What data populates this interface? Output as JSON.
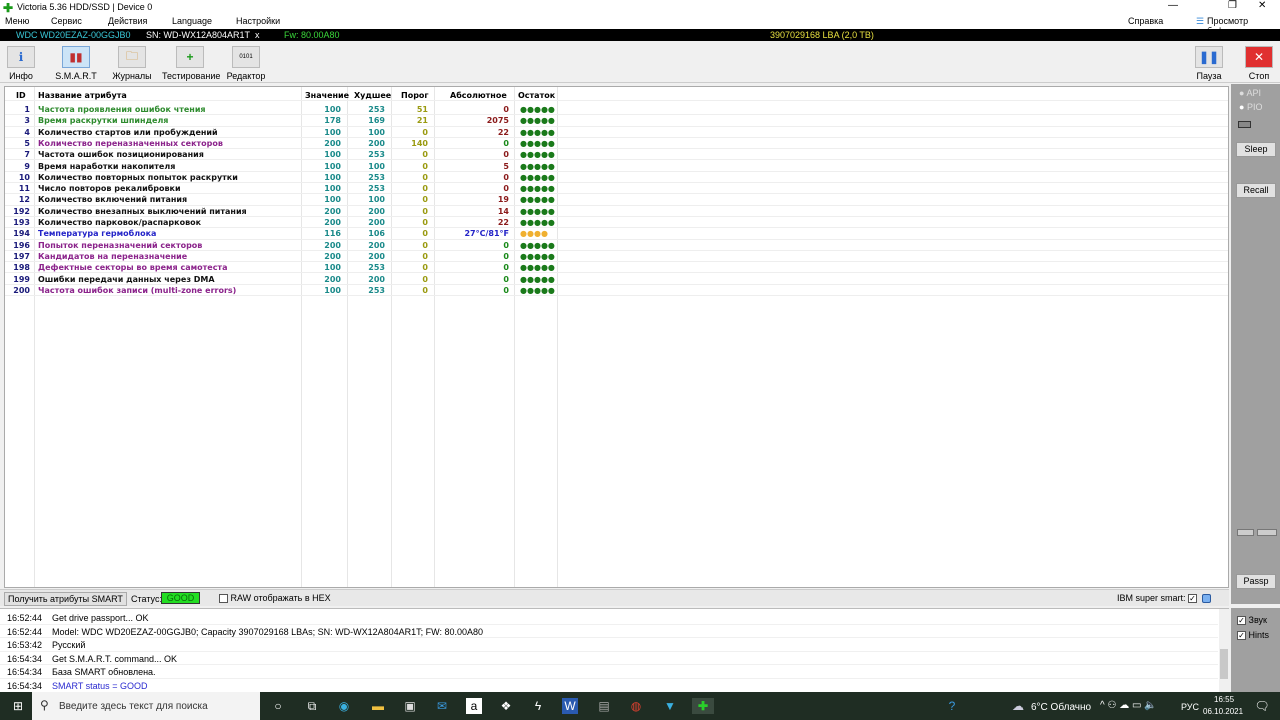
{
  "window": {
    "title": "Victoria 5.36 HDD/SSD | Device 0"
  },
  "menu": [
    "Меню",
    "Сервис",
    "Действия",
    "Language",
    "Настройки"
  ],
  "menu_right": {
    "help": "Справка",
    "buffer": "Просмотр буфера"
  },
  "infobar": {
    "model": "WDC WD20EZAZ-00GGJB0",
    "serial": "SN: WD-WX12A804AR1T",
    "close": "x",
    "fw": "Fw: 80.00A80",
    "lba": "3907029168 LBA (2,0 TB)"
  },
  "toolbar": {
    "info": "Инфо",
    "smart": "S.M.A.R.T",
    "logs": "Журналы",
    "test": "Тестирование",
    "editor": "Редактор",
    "pause": "Пауза",
    "stop": "Стоп"
  },
  "table": {
    "headers": {
      "id": "ID",
      "name": "Название атрибута",
      "value": "Значение",
      "worst": "Худшее",
      "threshold": "Порог",
      "raw": "Абсолютное",
      "rest": "Остаток"
    },
    "rows": [
      {
        "id": "1",
        "name": "Частота проявления ошибок чтения",
        "value": "100",
        "worst": "253",
        "threshold": "51",
        "raw": "0",
        "rest": "●●●●●",
        "nc": "#2e8b2e",
        "rc": "#8b1a1a"
      },
      {
        "id": "3",
        "name": "Время раскрутки шпинделя",
        "value": "178",
        "worst": "169",
        "threshold": "21",
        "raw": "2075",
        "rest": "●●●●●",
        "nc": "#2e8b2e",
        "rc": "#8b1a1a"
      },
      {
        "id": "4",
        "name": "Количество стартов или пробуждений",
        "value": "100",
        "worst": "100",
        "threshold": "0",
        "raw": "22",
        "rest": "●●●●●",
        "nc": "#111",
        "rc": "#8b1a1a"
      },
      {
        "id": "5",
        "name": "Количество переназначенных секторов",
        "value": "200",
        "worst": "200",
        "threshold": "140",
        "raw": "0",
        "rest": "●●●●●",
        "nc": "#8b238b",
        "rc": "#1a8a1a"
      },
      {
        "id": "7",
        "name": "Частота ошибок позиционирования",
        "value": "100",
        "worst": "253",
        "threshold": "0",
        "raw": "0",
        "rest": "●●●●●",
        "nc": "#111",
        "rc": "#8b1a1a"
      },
      {
        "id": "9",
        "name": "Время наработки накопителя",
        "value": "100",
        "worst": "100",
        "threshold": "0",
        "raw": "5",
        "rest": "●●●●●",
        "nc": "#111",
        "rc": "#8b1a1a"
      },
      {
        "id": "10",
        "name": "Количество повторных попыток раскрутки",
        "value": "100",
        "worst": "253",
        "threshold": "0",
        "raw": "0",
        "rest": "●●●●●",
        "nc": "#111",
        "rc": "#8b1a1a"
      },
      {
        "id": "11",
        "name": "Число повторов рекалибровки",
        "value": "100",
        "worst": "253",
        "threshold": "0",
        "raw": "0",
        "rest": "●●●●●",
        "nc": "#111",
        "rc": "#8b1a1a"
      },
      {
        "id": "12",
        "name": "Количество включений питания",
        "value": "100",
        "worst": "100",
        "threshold": "0",
        "raw": "19",
        "rest": "●●●●●",
        "nc": "#111",
        "rc": "#8b1a1a"
      },
      {
        "id": "192",
        "name": "Количество внезапных выключений питания",
        "value": "200",
        "worst": "200",
        "threshold": "0",
        "raw": "14",
        "rest": "●●●●●",
        "nc": "#111",
        "rc": "#8b1a1a"
      },
      {
        "id": "193",
        "name": "Количество парковок/распарковок",
        "value": "200",
        "worst": "200",
        "threshold": "0",
        "raw": "22",
        "rest": "●●●●●",
        "nc": "#111",
        "rc": "#8b1a1a"
      },
      {
        "id": "194",
        "name": "Температура гермоблока",
        "value": "116",
        "worst": "106",
        "threshold": "0",
        "raw": "27°C/81°F",
        "rest": "●●●●",
        "nc": "#2323c8",
        "rc": "#2323c8",
        "dc": "#f0b030"
      },
      {
        "id": "196",
        "name": "Попыток переназначений секторов",
        "value": "200",
        "worst": "200",
        "threshold": "0",
        "raw": "0",
        "rest": "●●●●●",
        "nc": "#8b238b",
        "rc": "#1a8a1a"
      },
      {
        "id": "197",
        "name": "Кандидатов на переназначение",
        "value": "200",
        "worst": "200",
        "threshold": "0",
        "raw": "0",
        "rest": "●●●●●",
        "nc": "#8b238b",
        "rc": "#1a8a1a"
      },
      {
        "id": "198",
        "name": "Дефектные секторы во время самотеста",
        "value": "100",
        "worst": "253",
        "threshold": "0",
        "raw": "0",
        "rest": "●●●●●",
        "nc": "#8b238b",
        "rc": "#1a8a1a"
      },
      {
        "id": "199",
        "name": "Ошибки передачи данных через DMA",
        "value": "200",
        "worst": "200",
        "threshold": "0",
        "raw": "0",
        "rest": "●●●●●",
        "nc": "#111",
        "rc": "#1a8a1a"
      },
      {
        "id": "200",
        "name": "Частота ошибок записи (multi-zone errors)",
        "value": "100",
        "worst": "253",
        "threshold": "0",
        "raw": "0",
        "rest": "●●●●●",
        "nc": "#8b238b",
        "rc": "#1a8a1a"
      }
    ]
  },
  "right_panel": {
    "api": "API",
    "pio": "PIO",
    "sleep": "Sleep",
    "recall": "Recall",
    "passp": "Passp",
    "sound": "Звук",
    "hints": "Hints"
  },
  "statusbar": {
    "get_smart": "Получить атрибуты SMART",
    "status_label": "Статус:",
    "status": "GOOD",
    "raw_hex": "RAW отображать в HEX",
    "ibm": "IBM super smart:"
  },
  "log": [
    {
      "time": "16:52:44",
      "text": "Get drive passport... OK"
    },
    {
      "time": "16:52:44",
      "text": "Model: WDC WD20EZAZ-00GGJB0; Capacity 3907029168 LBAs; SN: WD-WX12A804AR1T; FW: 80.00A80"
    },
    {
      "time": "16:53:42",
      "text": "Русский"
    },
    {
      "time": "16:54:34",
      "text": "Get S.M.A.R.T. command... OK"
    },
    {
      "time": "16:54:34",
      "text": "База SMART обновлена."
    },
    {
      "time": "16:54:34",
      "text": "SMART status = GOOD",
      "blue": true
    }
  ],
  "taskbar": {
    "search_placeholder": "Введите здесь текст для поиска",
    "weather": "6°C  Облачно",
    "lang": "РУС",
    "time": "16:55",
    "date": "06.10.2021"
  }
}
